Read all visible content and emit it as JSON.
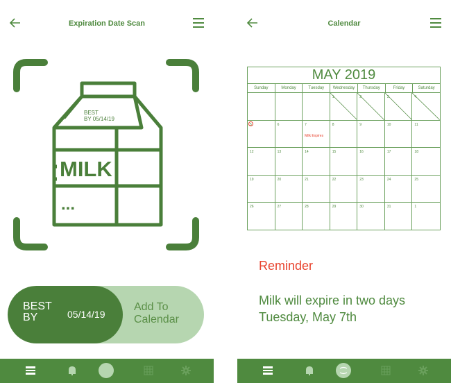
{
  "left": {
    "title": "Expiration Date Scan",
    "carton": {
      "best_by_text": "BEST\nBY",
      "date_line_1": "BEST",
      "date_line_2": "BY  05/14/19",
      "label": "MILK",
      "dots": "..."
    },
    "result": {
      "best_by_label": "BEST BY",
      "best_by_date": "05/14/19",
      "add_button_label": "Add To Calendar"
    }
  },
  "right": {
    "title": "Calendar",
    "calendar": {
      "month_year": "MAY 2019",
      "weekdays": [
        "Sunday",
        "Monday",
        "Tuesday",
        "Wednesday",
        "Thursday",
        "Friday",
        "Saturday"
      ],
      "cells": [
        "",
        "",
        "",
        "1",
        "2",
        "3",
        "4",
        "5",
        "6",
        "7",
        "8",
        "9",
        "10",
        "11",
        "12",
        "13",
        "14",
        "15",
        "16",
        "17",
        "18",
        "19",
        "20",
        "21",
        "22",
        "23",
        "24",
        "25",
        "26",
        "27",
        "28",
        "29",
        "30",
        "31",
        "1"
      ],
      "today": "5",
      "event": {
        "day": "7",
        "text": "Milk Expires"
      }
    },
    "reminder": {
      "title": "Reminder",
      "line1": "Milk will expire in two days",
      "line2": "Tuesday, May 7th"
    }
  },
  "nav": {
    "items": [
      "list-icon",
      "bell-icon",
      "camera-icon",
      "calendar-icon",
      "gear-icon"
    ]
  },
  "colors": {
    "primary": "#4f8a3f",
    "light": "#b6d6b0",
    "accent": "#e8432e"
  }
}
